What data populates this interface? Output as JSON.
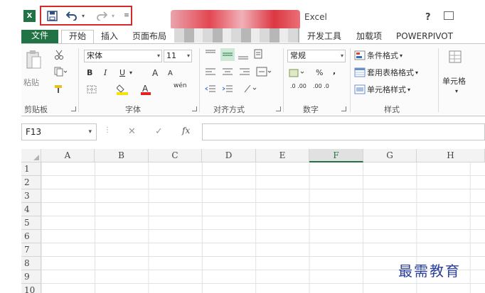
{
  "title_bar": {
    "app_name": "Excel",
    "help_label": "?"
  },
  "quick_access": {
    "save_icon": "save-icon",
    "undo_icon": "undo-icon",
    "redo_icon": "redo-icon",
    "customize_icon": "customize-qat-icon",
    "highlight_color": "#d42a2a"
  },
  "tabs": [
    {
      "label": "文件"
    },
    {
      "label": "开始"
    },
    {
      "label": "插入"
    },
    {
      "label": "页面布局"
    },
    {
      "label": "开发工具"
    },
    {
      "label": "加载项"
    },
    {
      "label": "POWERPIVOT"
    }
  ],
  "ribbon": {
    "clipboard": {
      "group_label": "剪贴板",
      "paste_label": "粘贴"
    },
    "font": {
      "group_label": "字体",
      "font_name": "宋体",
      "font_size": "11",
      "bold": "B",
      "italic": "I",
      "underline": "U",
      "grow": "A",
      "shrink": "A",
      "phonetic": "wén"
    },
    "alignment": {
      "group_label": "对齐方式"
    },
    "number": {
      "group_label": "数字",
      "format": "常规",
      "percent": "%",
      "comma": ",",
      "inc_decimal": ".0 .00",
      "dec_decimal": ".00 .0"
    },
    "styles": {
      "group_label": "样式",
      "conditional": "条件格式",
      "table_format": "套用表格格式",
      "cell_styles": "单元格样式"
    },
    "cells": {
      "insert_label": "单元格"
    }
  },
  "formula_bar": {
    "name_box": "F13",
    "cancel_symbol": "✕",
    "enter_symbol": "✓",
    "fx_label": "fx",
    "formula_value": ""
  },
  "grid": {
    "columns": [
      "A",
      "B",
      "C",
      "D",
      "E",
      "F",
      "G",
      "H"
    ],
    "selected_column": "F",
    "rows": [
      "1",
      "2",
      "3",
      "4",
      "5",
      "6",
      "7",
      "8",
      "9",
      "10"
    ],
    "accent_color": "#217346"
  },
  "watermark": {
    "text": "最需教育"
  }
}
